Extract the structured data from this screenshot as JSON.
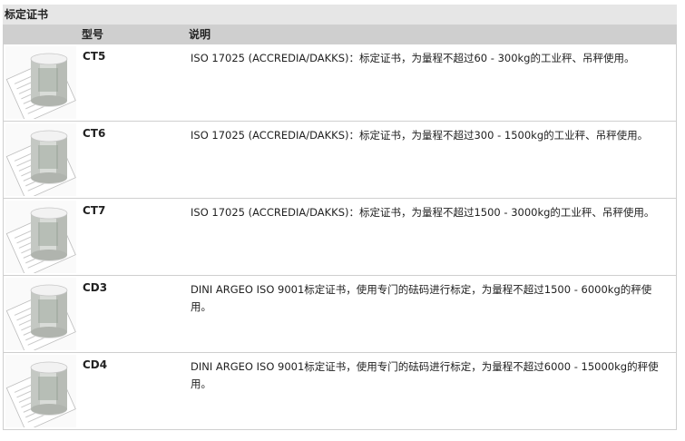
{
  "section": {
    "title": "标定证书"
  },
  "table": {
    "headers": {
      "model": "型号",
      "desc": "说明"
    },
    "rows": [
      {
        "model": "CT5",
        "desc": "ISO 17025 (ACCREDIA/DAKKS)：标定证书，为量程不超过60 - 300kg的工业秤、吊秤使用。"
      },
      {
        "model": "CT6",
        "desc": "ISO 17025 (ACCREDIA/DAKKS)：标定证书，为量程不超过300 - 1500kg的工业秤、吊秤使用。"
      },
      {
        "model": "CT7",
        "desc": "ISO 17025 (ACCREDIA/DAKKS)：标定证书，为量程不超过1500 - 3000kg的工业秤、吊秤使用。"
      },
      {
        "model": "CD3",
        "desc": "DINI ARGEO ISO 9001标定证书，使用专门的砝码进行标定，为量程不超过1500 - 6000kg的秤使用。"
      },
      {
        "model": "CD4",
        "desc": "DINI ARGEO ISO 9001标定证书，使用专门的砝码进行标定，为量程不超过6000 - 15000kg的秤使用。"
      }
    ]
  }
}
